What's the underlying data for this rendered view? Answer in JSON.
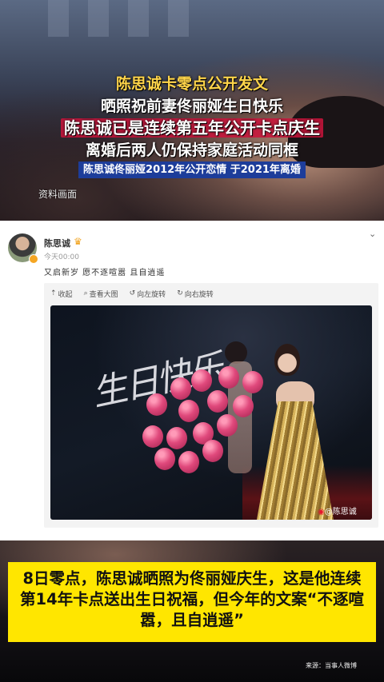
{
  "captions": {
    "line1": "陈思诚卡零点公开发文",
    "line2": "晒照祝前妻佟丽娅生日快乐",
    "line3": "陈思诚已是连续第五年公开卡点庆生",
    "line4": "离婚后两人仍保持家庭活动同框",
    "line5": "陈思诚佟丽娅2012年公开恋情 于2021年离婚",
    "footage_label": "资料画面"
  },
  "post": {
    "user_name": "陈思诚",
    "time": "今天00:00",
    "text": "又启新岁  愿不逐喧嚣  且自逍遥",
    "toolbar": {
      "collapse": "收起",
      "view_large": "查看大图",
      "rotate_left": "向左旋转",
      "rotate_right": "向右旋转"
    },
    "signature_text": "生日快乐",
    "watermark": "@陈思诚"
  },
  "bottom": {
    "subtitle": "8日零点，陈思诚晒照为佟丽娅庆生，这是他连续第14年卡点送出生日祝福，但今年的文案“不逐喧嚣，且自逍遥”",
    "source": "来源：当事人微博"
  },
  "colors": {
    "caption_yellow": "#ffd54a",
    "caption_red_bg": "#cc143c",
    "caption_blue_bg": "#1d3d9a",
    "subtitle_bg": "#ffe600",
    "weibo_red": "#e6162d"
  },
  "icons": [
    "collapse-icon",
    "zoom-icon",
    "rotate-left-icon",
    "rotate-right-icon",
    "dropdown-icon",
    "crown-icon",
    "weibo-icon"
  ]
}
